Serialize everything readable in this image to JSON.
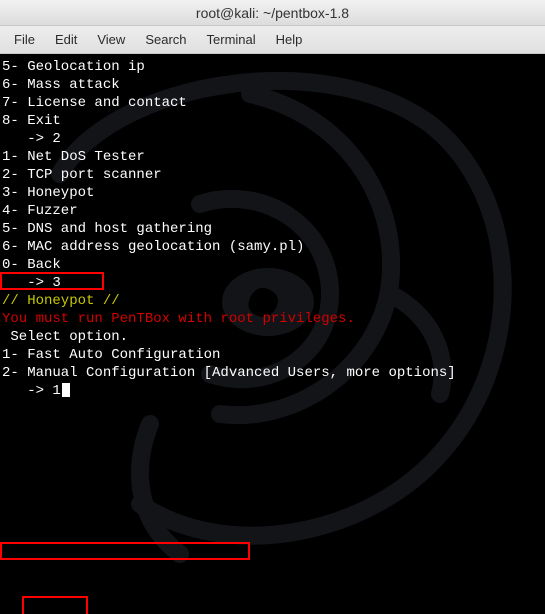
{
  "titlebar": {
    "text": "root@kali: ~/pentbox-1.8"
  },
  "menubar": {
    "items": [
      {
        "label": "File"
      },
      {
        "label": "Edit"
      },
      {
        "label": "View"
      },
      {
        "label": "Search"
      },
      {
        "label": "Terminal"
      },
      {
        "label": "Help"
      }
    ]
  },
  "terminal": {
    "lines": {
      "l0": "5- Geolocation ip",
      "l1": "",
      "l2": "6- Mass attack",
      "l3": "",
      "l4": "7- License and contact",
      "l5": "",
      "l6": "8- Exit",
      "l7": "",
      "l8": "   -> 2",
      "l9": "",
      "l10": "1- Net DoS Tester",
      "l11": "2- TCP port scanner",
      "l12": "3- Honeypot",
      "l13": "4- Fuzzer",
      "l14": "5- DNS and host gathering",
      "l15": "6- MAC address geolocation (samy.pl)",
      "l16": "",
      "l17": "0- Back",
      "l18": "",
      "l19": "   -> 3",
      "l20": "",
      "l21": "// Honeypot //",
      "l22": "",
      "l23": "You must run PenTBox with root privileges.",
      "l24": "",
      "l25": " Select option.",
      "l26": "",
      "l27": "1- Fast Auto Configuration",
      "l28": "2- Manual Configuration [Advanced Users, more options]",
      "l29": "",
      "l30_prefix": "   -> ",
      "l30_input": "1"
    }
  }
}
